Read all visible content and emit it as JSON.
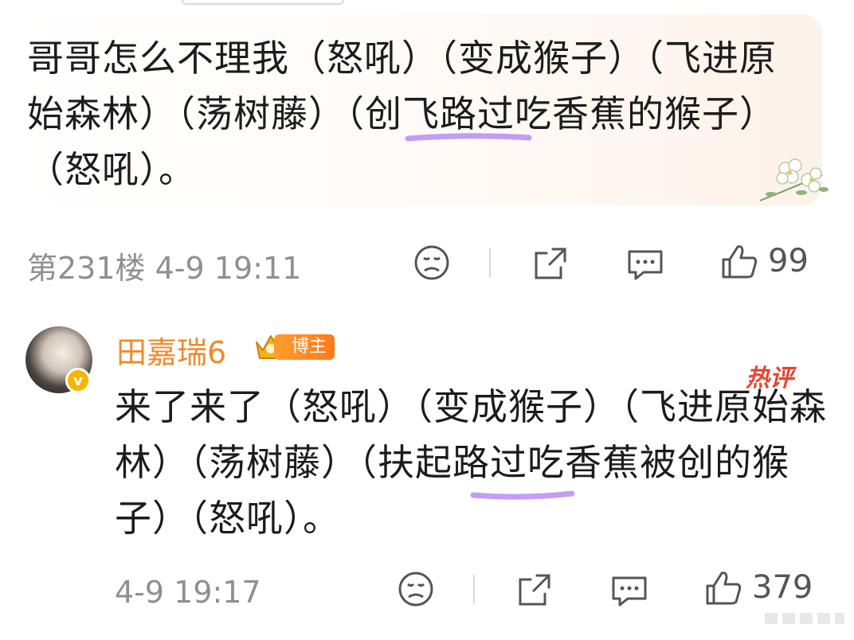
{
  "comment": {
    "text": "哥哥怎么不理我（怒吼）（变成猴子）（飞进原始森林）（荡树藤）（创飞路过吃香蕉的猴子）（怒吼）。",
    "floor": "第231楼",
    "time": "4-9 19:11",
    "like_count": "99"
  },
  "reply": {
    "username": "田嘉瑞6",
    "badge_label": "博主",
    "hot_tag": "热评",
    "text": "来了来了（怒吼）（变成猴子）（飞进原始森林）（荡树藤）（扶起路过吃香蕉被创的猴子）（怒吼）。",
    "time": "4-9 19:17",
    "like_count": "379"
  },
  "icons": {
    "emoji": "sad-face-icon",
    "share": "share-icon",
    "comment": "comment-icon",
    "like": "thumb-up-icon"
  },
  "colors": {
    "username": "#f08a2c",
    "highlight": "#b98cf5",
    "hot_tag": "#e8452f",
    "meta": "#8f8f8f"
  }
}
